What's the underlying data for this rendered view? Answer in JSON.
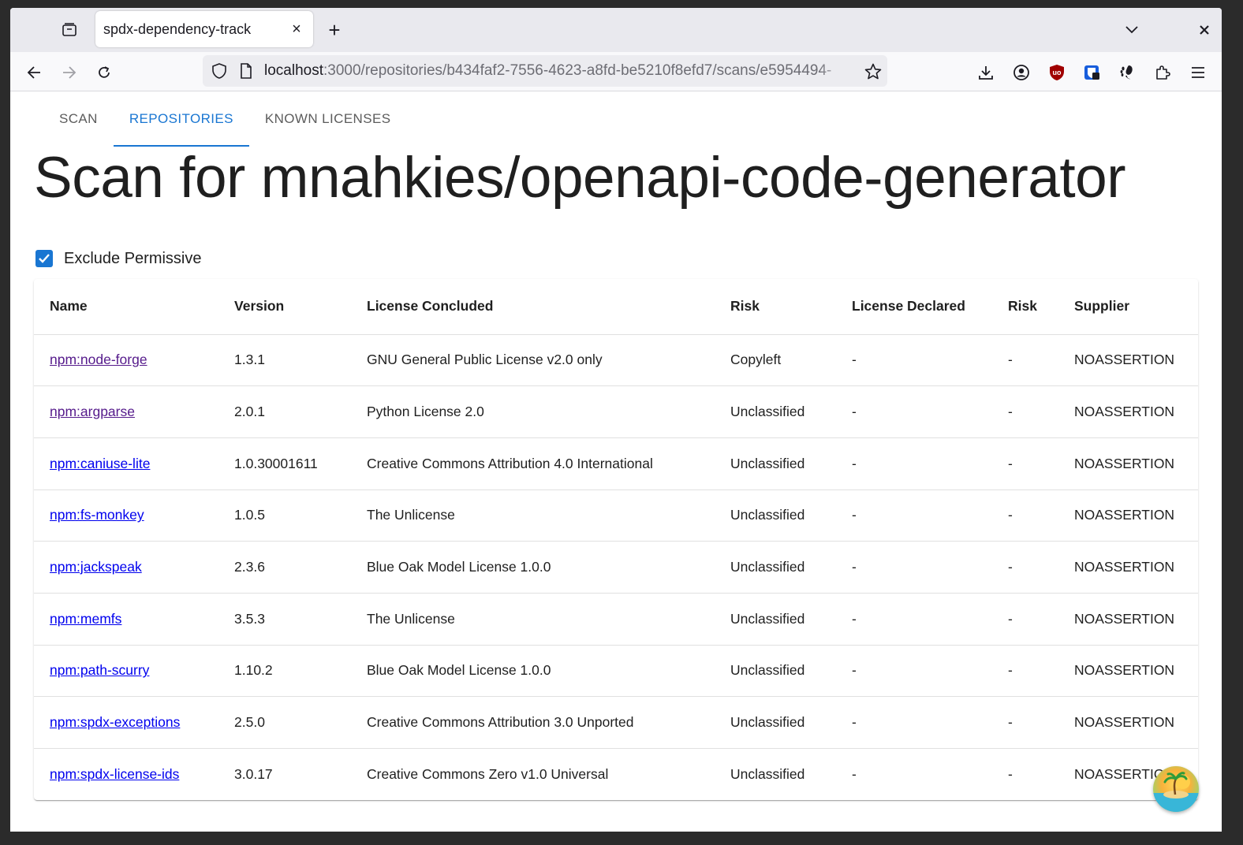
{
  "browser": {
    "tab_title": "spdx-dependency-track",
    "url_host": "localhost",
    "url_path": ":3000/repositories/b434faf2-7556-4623-a8fd-be5210f8efd7/scans/e5954494-",
    "tab_close": "×",
    "new_tab": "+"
  },
  "app_tabs": [
    {
      "label": "SCAN",
      "active": false
    },
    {
      "label": "REPOSITORIES",
      "active": true
    },
    {
      "label": "KNOWN LICENSES",
      "active": false
    }
  ],
  "page_title": "Scan for mnahkies/openapi-code-generator",
  "filter": {
    "label": "Exclude Permissive",
    "checked": true
  },
  "table": {
    "headers": [
      "Name",
      "Version",
      "License Concluded",
      "Risk",
      "License Declared",
      "Risk",
      "Supplier"
    ],
    "rows": [
      {
        "name": "npm:node-forge",
        "version": "1.3.1",
        "license_concluded": "GNU General Public License v2.0 only",
        "risk": "Copyleft",
        "license_declared": "-",
        "risk2": "-",
        "supplier": "NOASSERTION"
      },
      {
        "name": "npm:argparse",
        "version": "2.0.1",
        "license_concluded": "Python License 2.0",
        "risk": "Unclassified",
        "license_declared": "-",
        "risk2": "-",
        "supplier": "NOASSERTION"
      },
      {
        "name": "npm:caniuse-lite",
        "version": "1.0.30001611",
        "license_concluded": "Creative Commons Attribution 4.0 International",
        "risk": "Unclassified",
        "license_declared": "-",
        "risk2": "-",
        "supplier": "NOASSERTION"
      },
      {
        "name": "npm:fs-monkey",
        "version": "1.0.5",
        "license_concluded": "The Unlicense",
        "risk": "Unclassified",
        "license_declared": "-",
        "risk2": "-",
        "supplier": "NOASSERTION"
      },
      {
        "name": "npm:jackspeak",
        "version": "2.3.6",
        "license_concluded": "Blue Oak Model License 1.0.0",
        "risk": "Unclassified",
        "license_declared": "-",
        "risk2": "-",
        "supplier": "NOASSERTION"
      },
      {
        "name": "npm:memfs",
        "version": "3.5.3",
        "license_concluded": "The Unlicense",
        "risk": "Unclassified",
        "license_declared": "-",
        "risk2": "-",
        "supplier": "NOASSERTION"
      },
      {
        "name": "npm:path-scurry",
        "version": "1.10.2",
        "license_concluded": "Blue Oak Model License 1.0.0",
        "risk": "Unclassified",
        "license_declared": "-",
        "risk2": "-",
        "supplier": "NOASSERTION"
      },
      {
        "name": "npm:spdx-exceptions",
        "version": "2.5.0",
        "license_concluded": "Creative Commons Attribution 3.0 Unported",
        "risk": "Unclassified",
        "license_declared": "-",
        "risk2": "-",
        "supplier": "NOASSERTION"
      },
      {
        "name": "npm:spdx-license-ids",
        "version": "3.0.17",
        "license_concluded": "Creative Commons Zero v1.0 Universal",
        "risk": "Unclassified",
        "license_declared": "-",
        "risk2": "-",
        "supplier": "NOASSERTION"
      }
    ]
  },
  "colors": {
    "accent": "#1976d2",
    "link": "#0000ee",
    "visited_link": "#551a8b"
  },
  "icons": [
    "tab-overview-icon",
    "back-icon",
    "forward-icon",
    "reload-icon",
    "shield-icon",
    "page-icon",
    "star-icon",
    "download-icon",
    "account-icon",
    "ublock-icon",
    "bitwarden-icon",
    "gnome-icon",
    "extensions-icon",
    "menu-icon",
    "chevron-down-icon",
    "close-icon",
    "check-icon"
  ]
}
